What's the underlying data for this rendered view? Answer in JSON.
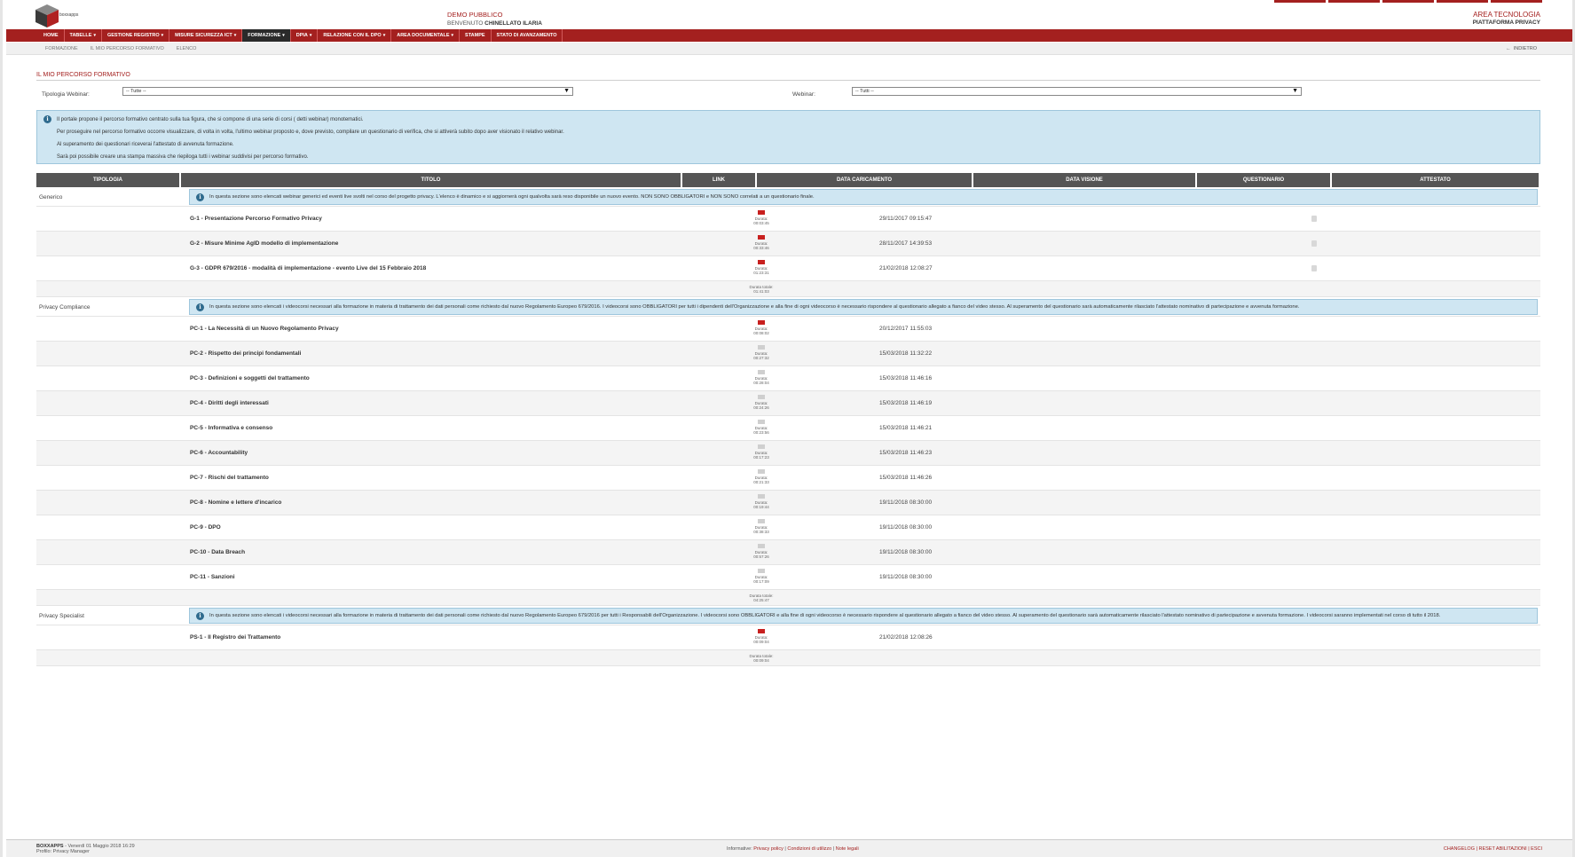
{
  "header": {
    "logo_text": "boxxapps",
    "demo": "DEMO PUBBLICO",
    "welcome_prefix": "BENVENUTO",
    "welcome_user": "CHINELLATO ILARIA",
    "area": "AREA TECNOLOGIA",
    "platform": "PIATTAFORMA PRIVACY"
  },
  "nav": [
    {
      "label": "HOME",
      "caret": ""
    },
    {
      "label": "TABELLE",
      "caret": "▾"
    },
    {
      "label": "GESTIONE REGISTRO",
      "caret": "▾"
    },
    {
      "label": "MISURE SICUREZZA ICT",
      "caret": "▾"
    },
    {
      "label": "FORMAZIONE",
      "caret": "▾"
    },
    {
      "label": "DPIA",
      "caret": "▾"
    },
    {
      "label": "RELAZIONE CON IL DPO",
      "caret": "▾"
    },
    {
      "label": "AREA DOCUMENTALE",
      "caret": "▾"
    },
    {
      "label": "STAMPE",
      "caret": ""
    },
    {
      "label": "STATO DI AVANZAMENTO",
      "caret": ""
    }
  ],
  "breadcrumb": [
    "FORMAZIONE",
    "IL MIO PERCORSO FORMATIVO",
    "ELENCO"
  ],
  "back_label": "INDIETRO",
  "page_title": "IL MIO PERCORSO FORMATIVO",
  "filters": {
    "tipologia_label": "Tipologia Webinar:",
    "tipologia_value": "-- Tutte --",
    "webinar_label": "Webinar:",
    "webinar_value": "-- Tutti --"
  },
  "info": [
    "Il portale propone il percorso formativo centrato sulla tua figura, che si compone di una serie di corsi ( detti webinar) monotematici.",
    "Per proseguire nel percorso formativo occorre visualizzare, di volta in volta, l'ultimo webinar proposto e, dove previsto, compilare un questionario di verifica, che si attiverà subito dopo aver visionato il relativo webinar.",
    "Al superamento dei questionari riceverai l'attestato di avvenuta formazione.",
    "Sarà poi possibile creare una stampa massiva che riepiloga tutti i webinar suddivisi per percorso formativo."
  ],
  "columns": [
    "TIPOLOGIA",
    "TITOLO",
    "LINK",
    "DATA CARICAMENTO",
    "DATA VISIONE",
    "QUESTIONARIO",
    "ATTESTATO"
  ],
  "duration_label": "Durata:",
  "total_label": "Durata totale:",
  "groups": [
    {
      "name": "Generico",
      "info": "In questa sezione sono elencati webinar generici ed eventi live svolti nel corso del progetto privacy. L'elenco è dinamico e si aggiornerà ogni qualvolta sarà reso disponibile un nuovo evento. NON SONO OBBLIGATORI e NON SONO correlati a un questionario finale.",
      "items": [
        {
          "title": "G-1 - Presentazione Percorso Formativo Privacy",
          "duration": "00:03:45",
          "date": "29/11/2017 09:15:47",
          "seen": true,
          "quiz": true
        },
        {
          "title": "G-2 - Misure Minime AgID modello di implementazione",
          "duration": "00:33:46",
          "date": "28/11/2017 14:39:53",
          "seen": true,
          "quiz": true
        },
        {
          "title": "G-3 - GDPR 679/2016 - modalità di implementazione - evento Live del 15 Febbraio 2018",
          "duration": "01:23:31",
          "date": "21/02/2018 12:08:27",
          "seen": true,
          "quiz": true
        }
      ],
      "total": "01:41:03"
    },
    {
      "name": "Privacy Compliance",
      "info": "In questa sezione sono elencati i videocorsi necessari alla formazione in materia di trattamento dei dati personali come richiesto dal nuovo Regolamento Europeo 679/2016. I videocorsi sono OBBLIGATORI per tutti i dipendenti dell'Organizzazione e alla fine di ogni videocorso è necessario rispondere al questionario allegato a fianco del video stesso. Al superamento del questionario sarà automaticamente rilasciato l'attestato nominativo di partecipazione e avvenuta formazione.",
      "items": [
        {
          "title": "PC-1 - La Necessità di un Nuovo Regolamento Privacy",
          "duration": "00:08:02",
          "date": "20/12/2017 11:55:03",
          "seen": true,
          "quiz": false
        },
        {
          "title": "PC-2 - Rispetto dei principi fondamentali",
          "duration": "00:27:32",
          "date": "15/03/2018 11:32:22",
          "seen": false,
          "quiz": false
        },
        {
          "title": "PC-3 - Definizioni e soggetti del trattamento",
          "duration": "00:28:04",
          "date": "15/03/2018 11:46:16",
          "seen": false,
          "quiz": false
        },
        {
          "title": "PC-4 - Diritti degli interessati",
          "duration": "00:24:26",
          "date": "15/03/2018 11:46:19",
          "seen": false,
          "quiz": false
        },
        {
          "title": "PC-5 - Informativa e consenso",
          "duration": "00:23:56",
          "date": "15/03/2018 11:46:21",
          "seen": false,
          "quiz": false
        },
        {
          "title": "PC-6 - Accountability",
          "duration": "00:17:23",
          "date": "15/03/2018 11:46:23",
          "seen": false,
          "quiz": false
        },
        {
          "title": "PC-7 - Rischi del trattamento",
          "duration": "00:21:33",
          "date": "15/03/2018 11:46:26",
          "seen": false,
          "quiz": false
        },
        {
          "title": "PC-8 - Nomine e lettere d'incarico",
          "duration": "00:19:44",
          "date": "19/11/2018 08:30:00",
          "seen": false,
          "quiz": false
        },
        {
          "title": "PC-9 - DPO",
          "duration": "00:38:33",
          "date": "19/11/2018 08:30:00",
          "seen": false,
          "quiz": false
        },
        {
          "title": "PC-10 - Data Breach",
          "duration": "00:57:26",
          "date": "19/11/2018 08:30:00",
          "seen": false,
          "quiz": false
        },
        {
          "title": "PC-11 - Sanzioni",
          "duration": "00:17:09",
          "date": "19/11/2018 08:30:00",
          "seen": false,
          "quiz": false
        }
      ],
      "total": "04:25:47"
    },
    {
      "name": "Privacy Specialist",
      "info": "In questa sezione sono elencati i videocorsi necessari alla formazione in materia di trattamento dei dati personali come richiesto dal nuovo Regolamento Europeo 679/2016 per tutti i Responsabili dell'Organizzazione. I videocorsi sono OBBLIGATORI e alla fine di ogni videocorso è necessario rispondere al questionario allegato a fianco del video stesso. Al superamento del questionario sarà automaticamente rilasciato l'attestato nominativo di partecipazione e avvenuta formazione. I videocorsi saranno implementati nel corso di tutto il 2018.",
      "items": [
        {
          "title": "PS-1 - Il Registro dei Trattamento",
          "duration": "00:09:04",
          "date": "21/02/2018 12:08:26",
          "seen": true,
          "quiz": false
        }
      ],
      "total": "00:09:04"
    }
  ],
  "footer": {
    "brand": "BOXXAPPS",
    "date": "- Venerdì 01 Maggio 2018 16:29",
    "profile": "Profilo: Privacy Manager",
    "info_label": "Informative:",
    "privacy": "Privacy policy",
    "conditions": "Condizioni di utilizzo",
    "legal": "Note legali",
    "right": "CHANGELOG | RESET ABILITAZIONI | ESCI"
  },
  "colors": {
    "brand": "#a4201f",
    "info_bg": "#cfe6f2",
    "header_bg": "#555555"
  }
}
